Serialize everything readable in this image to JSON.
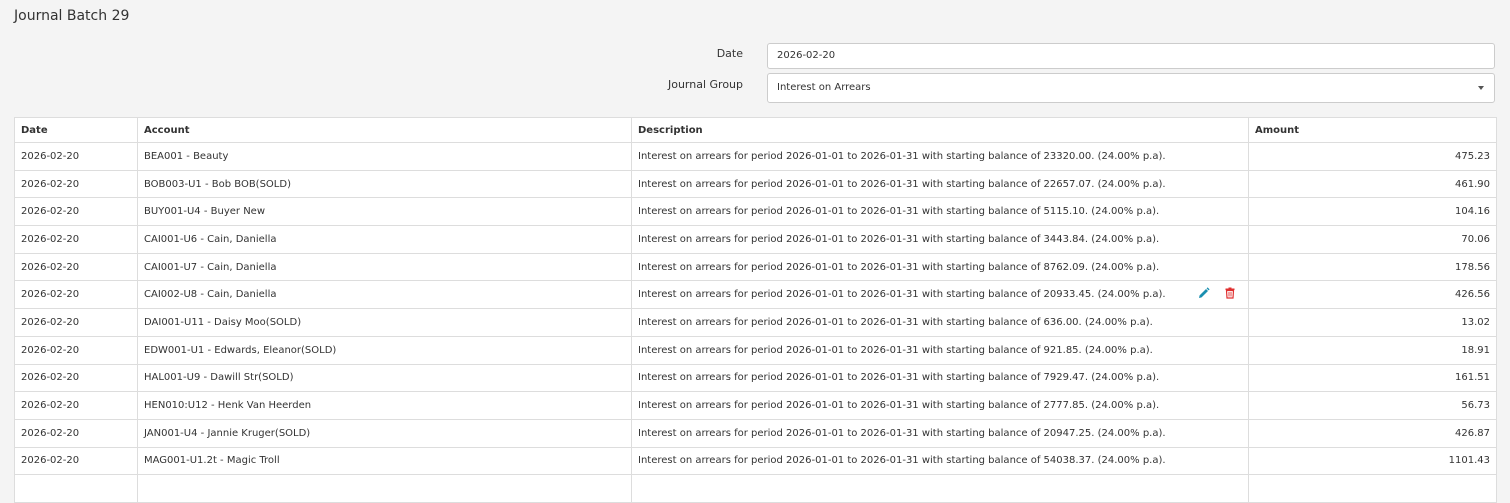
{
  "page": {
    "title": "Journal Batch 29"
  },
  "form": {
    "date_label": "Date",
    "date_value": "2026-02-20",
    "group_label": "Journal Group",
    "group_value": "Interest on Arrears"
  },
  "table": {
    "headers": {
      "date": "Date",
      "account": "Account",
      "description": "Description",
      "amount": "Amount"
    },
    "rows": [
      {
        "date": "2026-02-20",
        "account": "BEA001 - Beauty",
        "description": "Interest on arrears for period 2026-01-01 to 2026-01-31 with starting balance of 23320.00. (24.00% p.a).",
        "amount": "475.23"
      },
      {
        "date": "2026-02-20",
        "account": "BOB003-U1 - Bob BOB(SOLD)",
        "description": "Interest on arrears for period 2026-01-01 to 2026-01-31 with starting balance of 22657.07. (24.00% p.a).",
        "amount": "461.90"
      },
      {
        "date": "2026-02-20",
        "account": "BUY001-U4 - Buyer New",
        "description": "Interest on arrears for period 2026-01-01 to 2026-01-31 with starting balance of 5115.10. (24.00% p.a).",
        "amount": "104.16"
      },
      {
        "date": "2026-02-20",
        "account": "CAI001-U6 - Cain, Daniella",
        "description": "Interest on arrears for period 2026-01-01 to 2026-01-31 with starting balance of 3443.84. (24.00% p.a).",
        "amount": "70.06"
      },
      {
        "date": "2026-02-20",
        "account": "CAI001-U7 - Cain, Daniella",
        "description": "Interest on arrears for period 2026-01-01 to 2026-01-31 with starting balance of 8762.09. (24.00% p.a).",
        "amount": "178.56"
      },
      {
        "date": "2026-02-20",
        "account": "CAI002-U8 - Cain, Daniella",
        "description": "Interest on arrears for period 2026-01-01 to 2026-01-31 with starting balance of 20933.45. (24.00% p.a).",
        "amount": "426.56"
      },
      {
        "date": "2026-02-20",
        "account": "DAI001-U11 - Daisy Moo(SOLD)",
        "description": "Interest on arrears for period 2026-01-01 to 2026-01-31 with starting balance of 636.00. (24.00% p.a).",
        "amount": "13.02"
      },
      {
        "date": "2026-02-20",
        "account": "EDW001-U1 - Edwards, Eleanor(SOLD)",
        "description": "Interest on arrears for period 2026-01-01 to 2026-01-31 with starting balance of 921.85. (24.00% p.a).",
        "amount": "18.91"
      },
      {
        "date": "2026-02-20",
        "account": "HAL001-U9 - Dawill Str(SOLD)",
        "description": "Interest on arrears for period 2026-01-01 to 2026-01-31 with starting balance of 7929.47. (24.00% p.a).",
        "amount": "161.51"
      },
      {
        "date": "2026-02-20",
        "account": "HEN010:U12 - Henk Van Heerden",
        "description": "Interest on arrears for period 2026-01-01 to 2026-01-31 with starting balance of 2777.85. (24.00% p.a).",
        "amount": "56.73"
      },
      {
        "date": "2026-02-20",
        "account": "JAN001-U4 - Jannie Kruger(SOLD)",
        "description": "Interest on arrears for period 2026-01-01 to 2026-01-31 with starting balance of 20947.25. (24.00% p.a).",
        "amount": "426.87"
      },
      {
        "date": "2026-02-20",
        "account": "MAG001-U1.2t - Magic Troll",
        "description": "Interest on arrears for period 2026-01-01 to 2026-01-31 with starting balance of 54038.37. (24.00% p.a).",
        "amount": "1101.43"
      },
      {
        "date": "",
        "account": "",
        "description": "",
        "amount": ""
      }
    ]
  },
  "icons": {
    "edit": {
      "name": "pencil-icon",
      "color": "#1a8fb0"
    },
    "delete": {
      "name": "trash-icon",
      "color": "#e03030"
    }
  }
}
